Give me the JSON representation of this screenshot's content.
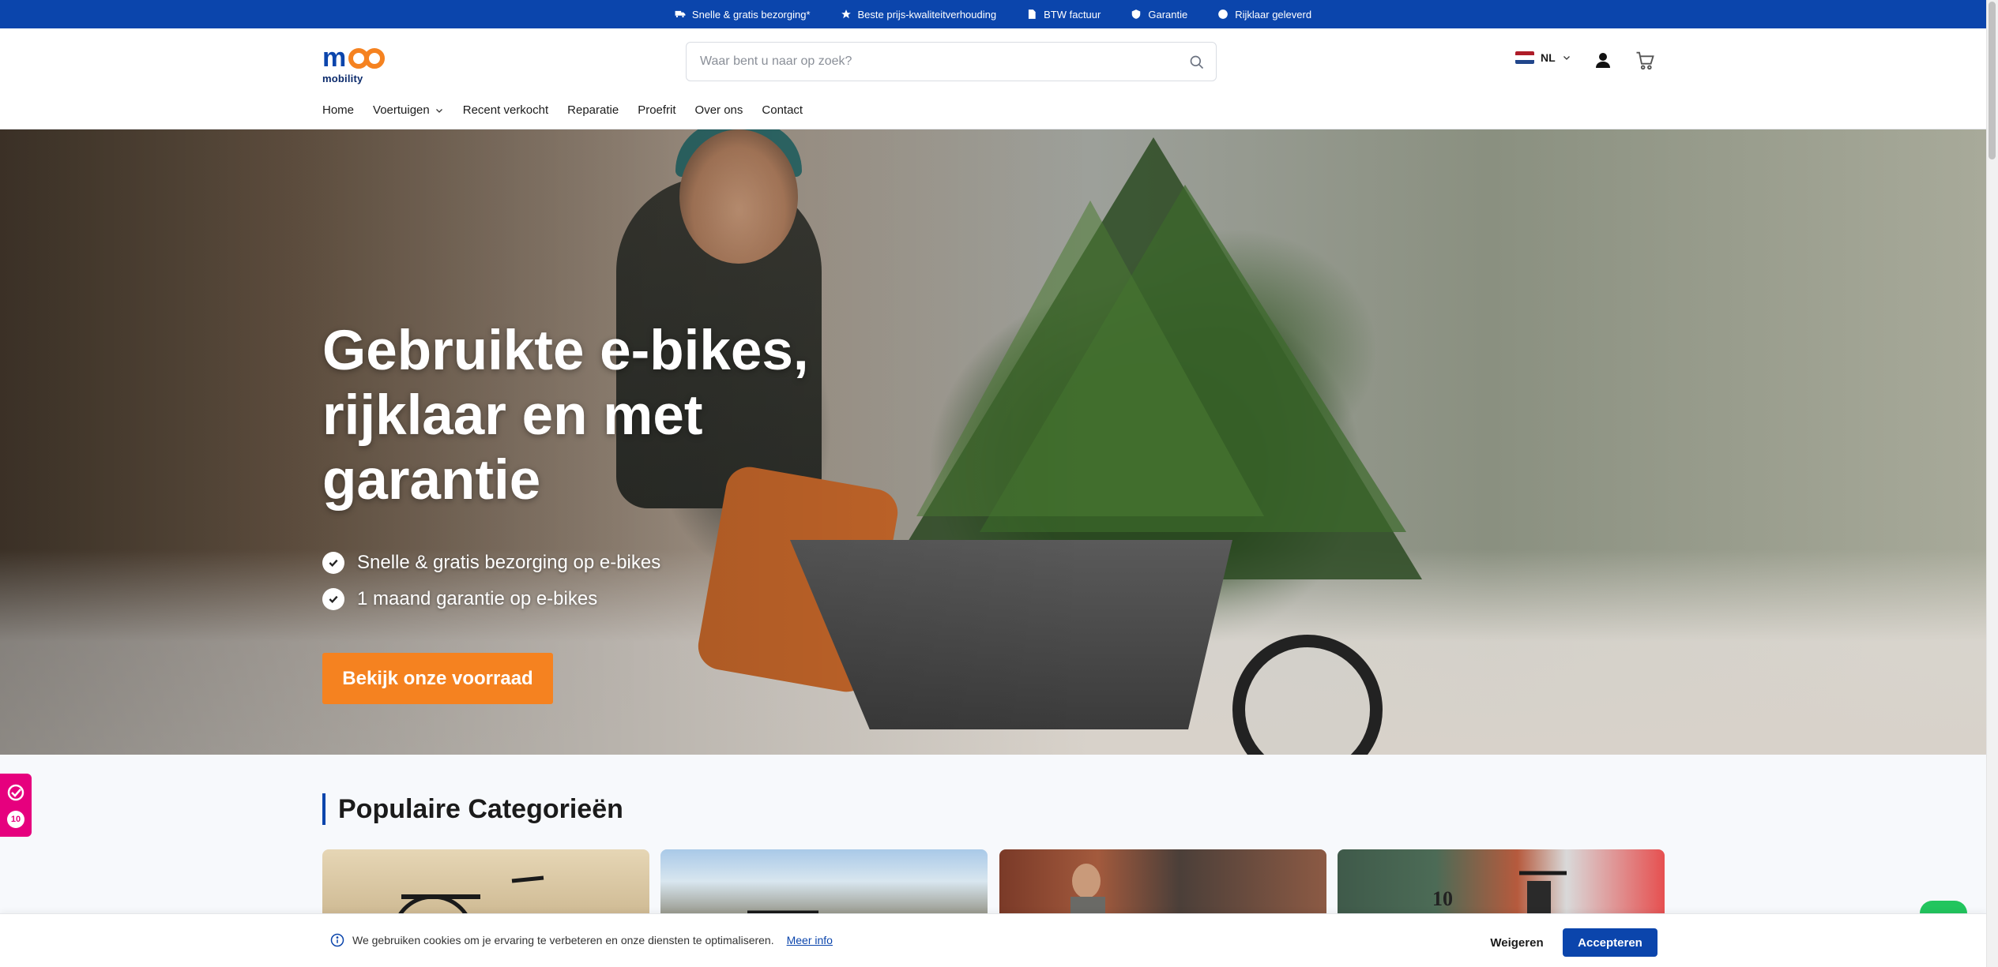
{
  "topbar": {
    "usps": [
      {
        "label": "Snelle & gratis bezorging*",
        "icon": "truck-icon"
      },
      {
        "label": "Beste prijs-kwaliteitverhouding",
        "icon": "star-icon"
      },
      {
        "label": "BTW factuur",
        "icon": "document-icon"
      },
      {
        "label": "Garantie",
        "icon": "shield-icon"
      },
      {
        "label": "Rijklaar geleverd",
        "icon": "check-circle-icon"
      }
    ],
    "background": "#0b45ac"
  },
  "header": {
    "logo_text": "mobility",
    "search_placeholder": "Waar bent u naar op zoek?",
    "language": "NL"
  },
  "nav": {
    "items": [
      "Home",
      "Voertuigen",
      "Recent verkocht",
      "Reparatie",
      "Proefrit",
      "Over ons",
      "Contact"
    ]
  },
  "hero": {
    "title": "Gebruikte e-bikes, rijklaar en met garantie",
    "bullets": [
      "Snelle & gratis bezorging op e-bikes",
      "1 maand garantie op e-bikes"
    ],
    "cta": "Bekijk onze voorraad",
    "cta_color": "#f58220"
  },
  "categories": {
    "title": "Populaire Categorieën",
    "card4_sign": "10"
  },
  "badge": {
    "count": "10",
    "color": "#e6007e"
  },
  "cookie": {
    "text": "We gebruiken cookies om je ervaring te verbeteren en onze diensten te optimaliseren.",
    "link": "Meer info",
    "refuse": "Weigeren",
    "accept": "Accepteren"
  }
}
